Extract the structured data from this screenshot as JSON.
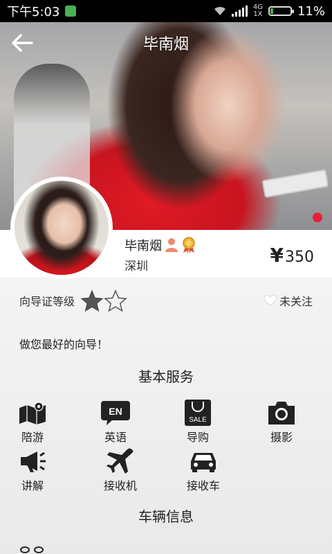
{
  "status_bar": {
    "time": "下午5:03",
    "network": [
      "4G",
      "1X"
    ],
    "battery": "11%"
  },
  "header": {
    "title": "毕南烟",
    "back_icon": "back-arrow-icon"
  },
  "profile": {
    "name": "毕南烟",
    "city": "深圳",
    "price_symbol": "¥",
    "price": "350",
    "badges": [
      "person-icon",
      "medal-icon"
    ]
  },
  "guide_level": {
    "label": "向导证等级",
    "stars_filled": 1,
    "stars_total": 2
  },
  "follow": {
    "label": "未关注"
  },
  "motto": "做您最好的向导！",
  "basic_services": {
    "title": "基本服务",
    "items": [
      {
        "label": "陪游",
        "icon": "map-pin-icon"
      },
      {
        "label": "英语",
        "icon": "en-bubble-icon",
        "icon_text": "EN"
      },
      {
        "label": "导购",
        "icon": "shopping-bag-icon",
        "icon_text": "SALE"
      },
      {
        "label": "摄影",
        "icon": "camera-icon"
      },
      {
        "label": "讲解",
        "icon": "megaphone-icon"
      },
      {
        "label": "接收机",
        "icon": "airplane-icon"
      },
      {
        "label": "接收车",
        "icon": "car-icon"
      }
    ]
  },
  "vehicle_info": {
    "title": "车辆信息"
  },
  "colors": {
    "accent_red": "#e8203a",
    "status_bg": "#000000",
    "battery_green": "#4caf50"
  }
}
